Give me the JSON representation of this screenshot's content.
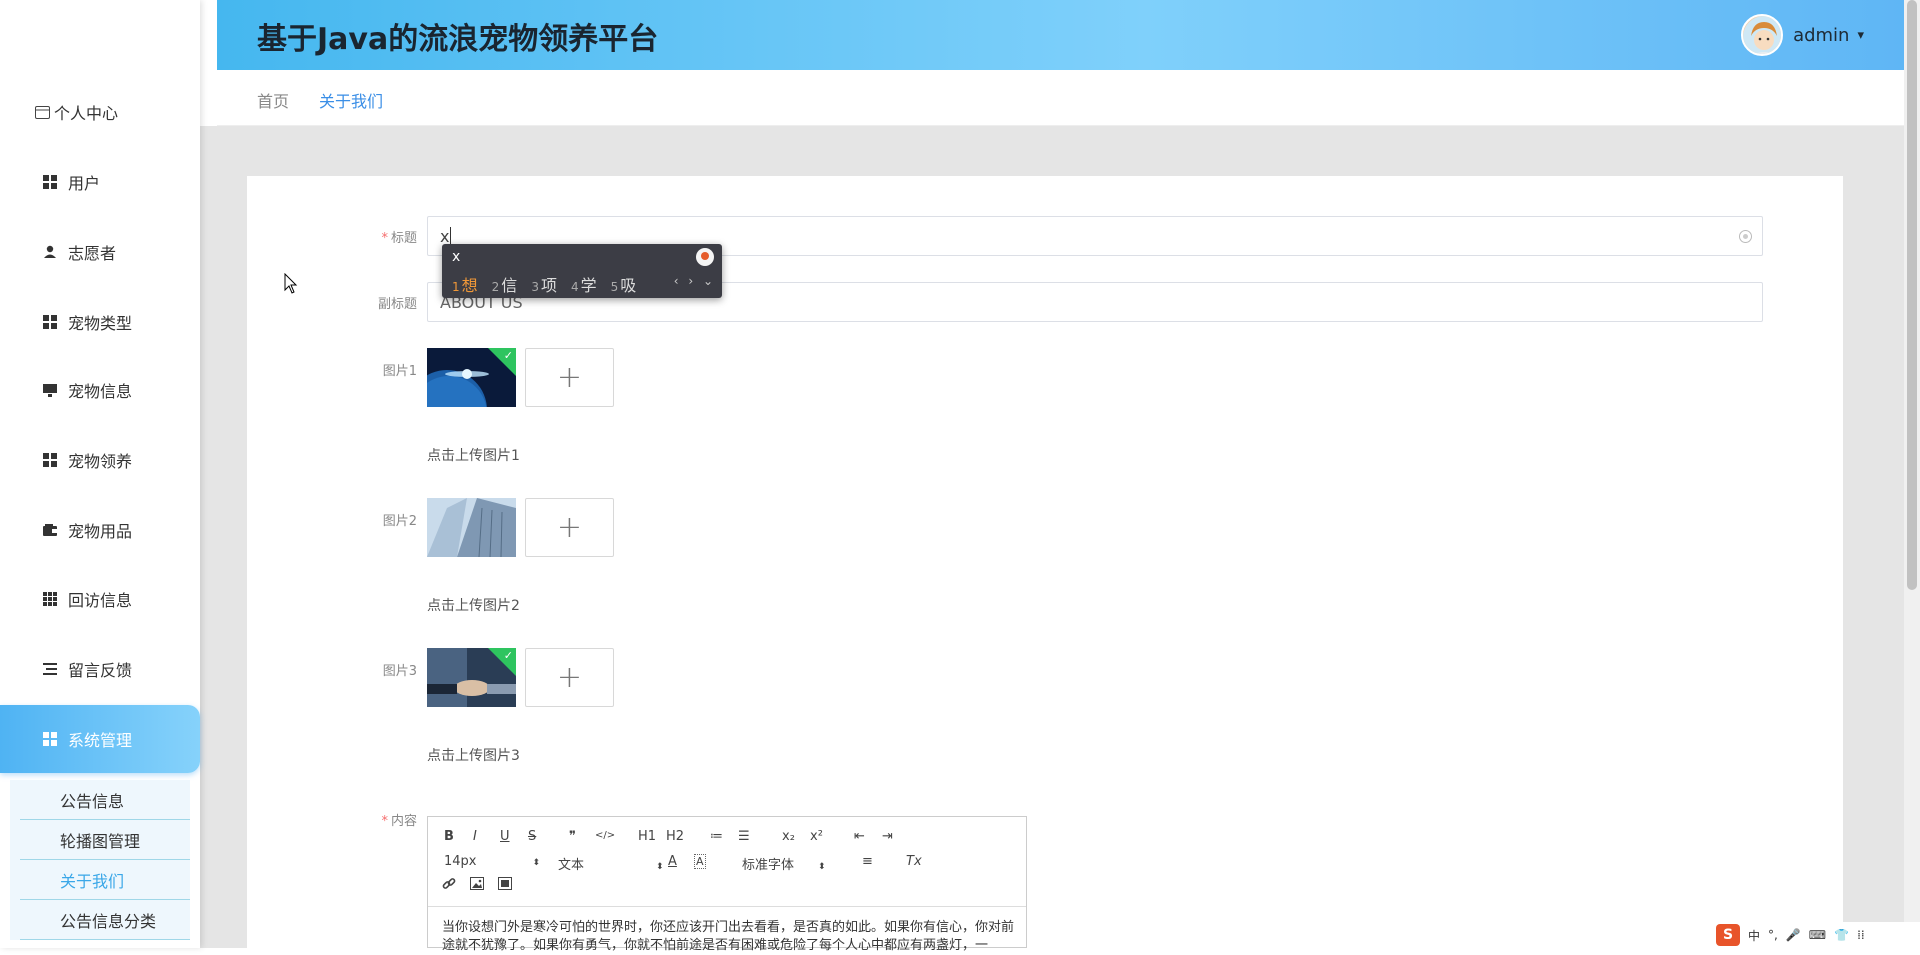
{
  "header": {
    "title": "基于Java的流浪宠物领养平台",
    "user_name": "admin",
    "caret": "▾"
  },
  "breadcrumb": {
    "home": "首页",
    "current": "关于我们"
  },
  "sidebar": {
    "items": [
      {
        "label": "个人中心",
        "icon": "card-icon"
      },
      {
        "label": "用户",
        "icon": "grid-icon"
      },
      {
        "label": "志愿者",
        "icon": "person-icon"
      },
      {
        "label": "宠物类型",
        "icon": "grid-icon"
      },
      {
        "label": "宠物信息",
        "icon": "monitor-icon"
      },
      {
        "label": "宠物领养",
        "icon": "grid-icon"
      },
      {
        "label": "宠物用品",
        "icon": "wallet-icon"
      },
      {
        "label": "回访信息",
        "icon": "table-icon"
      },
      {
        "label": "留言反馈",
        "icon": "list-icon"
      },
      {
        "label": "系统管理",
        "icon": "grid-icon"
      }
    ],
    "submenu": [
      "公告信息",
      "轮播图管理",
      "关于我们",
      "公告信息分类"
    ],
    "active_color": "#4fb3f3"
  },
  "form": {
    "title_label": "标题",
    "title_value": "x",
    "subtitle_label": "副标题",
    "subtitle_value": "ABOUT US",
    "pic1_label": "图片1",
    "pic1_hint": "点击上传图片1",
    "pic2_label": "图片2",
    "pic2_hint": "点击上传图片2",
    "pic3_label": "图片3",
    "pic3_hint": "点击上传图片3",
    "content_label": "内容",
    "upload_plus": "+",
    "required_mark": "*"
  },
  "ime": {
    "input": "x",
    "candidates": [
      {
        "n": "1",
        "text": "想"
      },
      {
        "n": "2",
        "text": "信"
      },
      {
        "n": "3",
        "text": "项"
      },
      {
        "n": "4",
        "text": "学"
      },
      {
        "n": "5",
        "text": "吸"
      }
    ],
    "nav": "‹ › ⌄"
  },
  "editor": {
    "toolbar_row1": [
      "B",
      "I",
      "U",
      "S",
      "❞",
      "</>",
      "H1",
      "H2",
      "≔",
      "☰",
      "x₂",
      "x²",
      "⇤",
      "⇥"
    ],
    "font_size": "14px",
    "header_select": "文本",
    "font_family": "标准字体",
    "toolbar_row2": [
      "A",
      "A",
      "≡",
      "Tx"
    ],
    "toolbar_row3": [
      "link",
      "image",
      "video"
    ],
    "content": "当你设想门外是寒冷可怕的世界时，你还应该开门出去看看，是否真的如此。如果你有信心，你对前途就不犹豫了。如果你有勇气，你就不怕前途是否有困难或危险了每个人心中都应有两盏灯，一"
  },
  "tray": {
    "items": [
      "中",
      "°,",
      "🎤",
      "⌨",
      "👕",
      "⁞⁞"
    ]
  }
}
